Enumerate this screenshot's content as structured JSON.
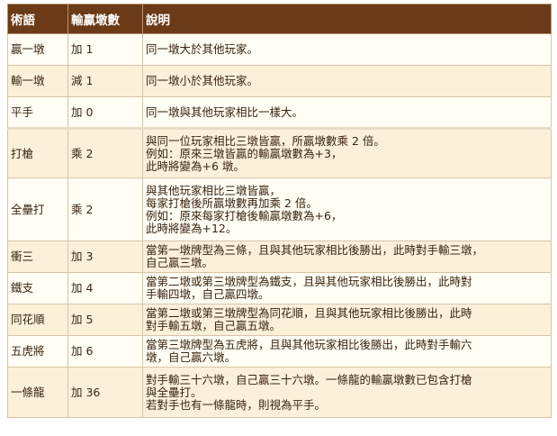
{
  "headers": [
    "術語",
    "輸贏墩數",
    "說明"
  ],
  "rows": [
    {
      "term": "贏一墩",
      "value": "加 1",
      "desc": [
        "同一墩大於其他玩家。"
      ]
    },
    {
      "term": "輸一墩",
      "value": "減 1",
      "desc": [
        "同一墩小於其他玩家。"
      ]
    },
    {
      "term": "平手",
      "value": "加 0",
      "desc": [
        "同一墩與其他玩家相比一樣大。"
      ]
    },
    {
      "term": "打槍",
      "value": "乘 2",
      "desc": [
        "與同一位玩家相比三墩皆贏，所贏墩數乘 2 倍。",
        "例如：原來三墩皆贏的輸贏墩數為+3，",
        "此時將變為+6 墩。"
      ]
    },
    {
      "term": "全壘打",
      "value": "乘 2",
      "desc": [
        "與其他玩家相比三墩皆贏，",
        "每家打槍後所贏墩數再加乘 2 倍。",
        "例如：原來每家打槍後輸贏墩數為+6，",
        "此時將變為+12。"
      ]
    },
    {
      "term": "衝三",
      "value": "加 3",
      "desc": [
        "當第一墩牌型為三條，且與其他玩家相比後勝出，此時對手輸三墩，",
        "自己贏三墩。"
      ]
    },
    {
      "term": "鐵支",
      "value": "加 4",
      "desc": [
        "當第二墩或第三墩牌型為鐵支，且與其他玩家相比後勝出，此時對",
        "手輸四墩，自己贏四墩。"
      ]
    },
    {
      "term": "同花順",
      "value": "加 5",
      "desc": [
        "當第二墩或第三墩牌型為同花順，且與其他玩家相比後勝出，此時",
        "對手輸五墩，自己贏五墩。"
      ]
    },
    {
      "term": "五虎將",
      "value": "加 6",
      "desc": [
        "當第三墩牌型為五虎將，且與其他玩家相比後勝出，此時對手輸六",
        "墩，自己贏六墩。"
      ]
    },
    {
      "term": "一條龍",
      "value": "加 36",
      "desc": [
        "對手輸三十六墩，自己贏三十六墩。一條龍的輸贏墩數已包含打槍",
        "與全壘打。",
        "若對手也有一條龍時，則視為平手。"
      ]
    }
  ]
}
